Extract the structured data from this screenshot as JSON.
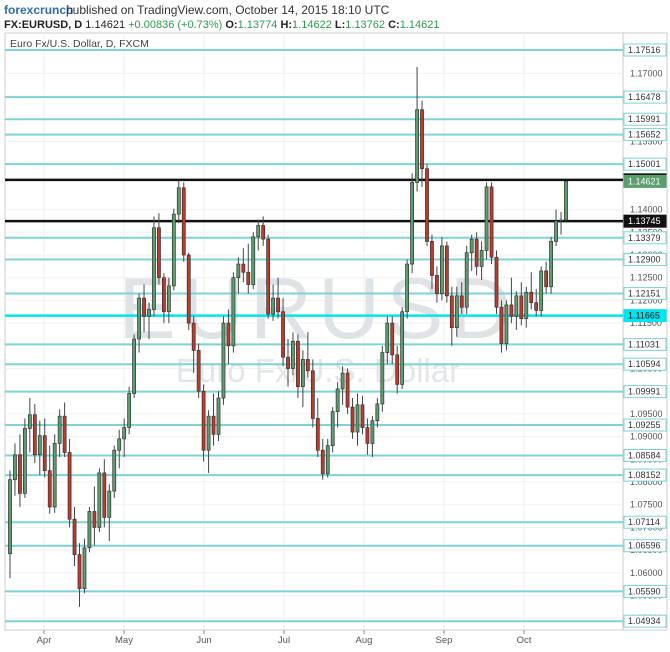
{
  "header": {
    "brand": "forexcrunch",
    "published": "published on TradingView.com, October 14, 2015 18:10 UTC"
  },
  "ohlc": {
    "symbol": "FX:EURUSD, D",
    "last": "1.14621",
    "change": "+0.00836 (+0.73%)",
    "open_label": "O:",
    "open": "1.13774",
    "high_label": "H:",
    "high": "1.14622",
    "low_label": "L:",
    "low": "1.13762",
    "close_label": "C:",
    "close": "1.14621"
  },
  "colors": {
    "up": "#5a9e6e",
    "down": "#c0392b",
    "level_line": "#7fd3d6",
    "key_line": "#111111",
    "highlight_line": "#00e5ef",
    "grid": "#eef0f2"
  },
  "chart_data": {
    "type": "candlestick",
    "title": "Euro Fx/U.S. Dollar, D, FXCM",
    "watermark": "EURUSD",
    "watermark_sub": "Euro Fx/U.S. Dollar",
    "x_ticks": [
      "Apr",
      "May",
      "Jun",
      "Jul",
      "Aug",
      "Sep",
      "Oct"
    ],
    "y_ticks": [
      "1.17000",
      "1.16500",
      "1.15500",
      "1.15000",
      "1.14000",
      "1.13500",
      "1.13000",
      "1.12500",
      "1.12000",
      "1.11500",
      "1.10500",
      "1.10000",
      "1.09500",
      "1.09000",
      "1.08500",
      "1.08000",
      "1.07500",
      "1.07000",
      "1.06500",
      "1.06000",
      "1.05500",
      "1.05000"
    ],
    "ylim": [
      1.0474,
      1.1789
    ],
    "levels": [
      {
        "value": 1.17516,
        "label": "1.17516",
        "style": "level"
      },
      {
        "value": 1.16478,
        "label": "1.16478",
        "style": "level"
      },
      {
        "value": 1.15991,
        "label": "1.15991",
        "style": "level"
      },
      {
        "value": 1.15652,
        "label": "1.15652",
        "style": "level"
      },
      {
        "value": 1.15001,
        "label": "1.15001",
        "style": "level"
      },
      {
        "value": 1.14656,
        "label": "1.14656",
        "style": "key"
      },
      {
        "value": 1.13745,
        "label": "1.13745",
        "style": "key"
      },
      {
        "value": 1.13379,
        "label": "1.13379",
        "style": "level"
      },
      {
        "value": 1.129,
        "label": "1.12900",
        "style": "level"
      },
      {
        "value": 1.12151,
        "label": "1.12151",
        "style": "level"
      },
      {
        "value": 1.11665,
        "label": "1.11665",
        "style": "highlight"
      },
      {
        "value": 1.11031,
        "label": "1.11031",
        "style": "level"
      },
      {
        "value": 1.10594,
        "label": "1.10594",
        "style": "level"
      },
      {
        "value": 1.09991,
        "label": "1.09991",
        "style": "level"
      },
      {
        "value": 1.09255,
        "label": "1.09255",
        "style": "level"
      },
      {
        "value": 1.08584,
        "label": "1.08584",
        "style": "level"
      },
      {
        "value": 1.08152,
        "label": "1.08152",
        "style": "level"
      },
      {
        "value": 1.07114,
        "label": "1.07114",
        "style": "level"
      },
      {
        "value": 1.06596,
        "label": "1.06596",
        "style": "level"
      },
      {
        "value": 1.0559,
        "label": "1.05590",
        "style": "level"
      },
      {
        "value": 1.04934,
        "label": "1.04934",
        "style": "level"
      }
    ],
    "last_price": {
      "value": 1.14621,
      "label": "1.14621"
    },
    "candles": [
      {
        "o": 1.0642,
        "h": 1.0825,
        "l": 1.0588,
        "c": 1.0805
      },
      {
        "o": 1.0805,
        "h": 1.0885,
        "l": 1.077,
        "c": 1.086
      },
      {
        "o": 1.086,
        "h": 1.0905,
        "l": 1.0745,
        "c": 1.0775
      },
      {
        "o": 1.0775,
        "h": 1.094,
        "l": 1.0765,
        "c": 1.0918
      },
      {
        "o": 1.0918,
        "h": 1.0985,
        "l": 1.0865,
        "c": 1.0948
      },
      {
        "o": 1.0948,
        "h": 1.0972,
        "l": 1.0842,
        "c": 1.086
      },
      {
        "o": 1.086,
        "h": 1.0935,
        "l": 1.0815,
        "c": 1.0902
      },
      {
        "o": 1.0902,
        "h": 1.094,
        "l": 1.081,
        "c": 1.0825
      },
      {
        "o": 1.0825,
        "h": 1.088,
        "l": 1.073,
        "c": 1.0745
      },
      {
        "o": 1.0745,
        "h": 1.0905,
        "l": 1.0732,
        "c": 1.0885
      },
      {
        "o": 1.0885,
        "h": 1.096,
        "l": 1.0855,
        "c": 1.0945
      },
      {
        "o": 1.0945,
        "h": 1.0975,
        "l": 1.0855,
        "c": 1.0865
      },
      {
        "o": 1.0865,
        "h": 1.0895,
        "l": 1.07,
        "c": 1.0718
      },
      {
        "o": 1.0718,
        "h": 1.0745,
        "l": 1.0615,
        "c": 1.064
      },
      {
        "o": 1.064,
        "h": 1.0665,
        "l": 1.0525,
        "c": 1.0565
      },
      {
        "o": 1.0565,
        "h": 1.0675,
        "l": 1.0555,
        "c": 1.0655
      },
      {
        "o": 1.0655,
        "h": 1.0745,
        "l": 1.0645,
        "c": 1.0735
      },
      {
        "o": 1.0735,
        "h": 1.079,
        "l": 1.066,
        "c": 1.07
      },
      {
        "o": 1.07,
        "h": 1.083,
        "l": 1.069,
        "c": 1.082
      },
      {
        "o": 1.082,
        "h": 1.085,
        "l": 1.07,
        "c": 1.0722
      },
      {
        "o": 1.0722,
        "h": 1.0795,
        "l": 1.067,
        "c": 1.078
      },
      {
        "o": 1.078,
        "h": 1.088,
        "l": 1.0765,
        "c": 1.087
      },
      {
        "o": 1.087,
        "h": 1.0915,
        "l": 1.083,
        "c": 1.0895
      },
      {
        "o": 1.0895,
        "h": 1.094,
        "l": 1.0855,
        "c": 1.092
      },
      {
        "o": 1.092,
        "h": 1.101,
        "l": 1.0905,
        "c": 1.0995
      },
      {
        "o": 1.0995,
        "h": 1.1125,
        "l": 1.0985,
        "c": 1.1115
      },
      {
        "o": 1.1115,
        "h": 1.1215,
        "l": 1.1085,
        "c": 1.1205
      },
      {
        "o": 1.1205,
        "h": 1.1235,
        "l": 1.113,
        "c": 1.1165
      },
      {
        "o": 1.1165,
        "h": 1.1195,
        "l": 1.1115,
        "c": 1.118
      },
      {
        "o": 1.118,
        "h": 1.1385,
        "l": 1.1165,
        "c": 1.136
      },
      {
        "o": 1.136,
        "h": 1.1392,
        "l": 1.1235,
        "c": 1.125
      },
      {
        "o": 1.125,
        "h": 1.126,
        "l": 1.115,
        "c": 1.1175
      },
      {
        "o": 1.1175,
        "h": 1.125,
        "l": 1.115,
        "c": 1.1232
      },
      {
        "o": 1.1232,
        "h": 1.1402,
        "l": 1.1222,
        "c": 1.139
      },
      {
        "o": 1.139,
        "h": 1.1466,
        "l": 1.137,
        "c": 1.1448
      },
      {
        "o": 1.1448,
        "h": 1.146,
        "l": 1.1285,
        "c": 1.13
      },
      {
        "o": 1.13,
        "h": 1.1305,
        "l": 1.1135,
        "c": 1.115
      },
      {
        "o": 1.115,
        "h": 1.1165,
        "l": 1.104,
        "c": 1.109
      },
      {
        "o": 1.109,
        "h": 1.1105,
        "l": 1.0985,
        "c": 1.1
      },
      {
        "o": 1.1,
        "h": 1.1015,
        "l": 1.0845,
        "c": 1.087
      },
      {
        "o": 1.087,
        "h": 1.0958,
        "l": 1.082,
        "c": 1.0945
      },
      {
        "o": 1.0945,
        "h": 1.0995,
        "l": 1.088,
        "c": 1.0905
      },
      {
        "o": 1.0905,
        "h": 1.1,
        "l": 1.089,
        "c": 1.0985
      },
      {
        "o": 1.0985,
        "h": 1.1165,
        "l": 1.097,
        "c": 1.115
      },
      {
        "o": 1.115,
        "h": 1.118,
        "l": 1.106,
        "c": 1.11
      },
      {
        "o": 1.11,
        "h": 1.1262,
        "l": 1.1085,
        "c": 1.125
      },
      {
        "o": 1.125,
        "h": 1.1295,
        "l": 1.1215,
        "c": 1.128
      },
      {
        "o": 1.128,
        "h": 1.1315,
        "l": 1.124,
        "c": 1.1262
      },
      {
        "o": 1.1262,
        "h": 1.1325,
        "l": 1.1215,
        "c": 1.1235
      },
      {
        "o": 1.1235,
        "h": 1.135,
        "l": 1.1225,
        "c": 1.134
      },
      {
        "o": 1.134,
        "h": 1.1378,
        "l": 1.131,
        "c": 1.1365
      },
      {
        "o": 1.1365,
        "h": 1.1385,
        "l": 1.132,
        "c": 1.1335
      },
      {
        "o": 1.1335,
        "h": 1.1345,
        "l": 1.116,
        "c": 1.117
      },
      {
        "o": 1.117,
        "h": 1.1235,
        "l": 1.1155,
        "c": 1.1205
      },
      {
        "o": 1.1205,
        "h": 1.125,
        "l": 1.116,
        "c": 1.1175
      },
      {
        "o": 1.1175,
        "h": 1.1205,
        "l": 1.1055,
        "c": 1.1075
      },
      {
        "o": 1.1075,
        "h": 1.1115,
        "l": 1.101,
        "c": 1.105
      },
      {
        "o": 1.105,
        "h": 1.113,
        "l": 1.1035,
        "c": 1.111
      },
      {
        "o": 1.111,
        "h": 1.1125,
        "l": 1.0985,
        "c": 1.101
      },
      {
        "o": 1.101,
        "h": 1.109,
        "l": 1.0965,
        "c": 1.107
      },
      {
        "o": 1.107,
        "h": 1.113,
        "l": 1.103,
        "c": 1.1045
      },
      {
        "o": 1.1045,
        "h": 1.107,
        "l": 1.092,
        "c": 1.094
      },
      {
        "o": 1.094,
        "h": 1.0985,
        "l": 1.0855,
        "c": 1.087
      },
      {
        "o": 1.087,
        "h": 1.0895,
        "l": 1.0805,
        "c": 1.0818
      },
      {
        "o": 1.0818,
        "h": 1.0895,
        "l": 1.081,
        "c": 1.088
      },
      {
        "o": 1.088,
        "h": 1.0965,
        "l": 1.0865,
        "c": 1.0955
      },
      {
        "o": 1.0955,
        "h": 1.102,
        "l": 1.092,
        "c": 1.1005
      },
      {
        "o": 1.1005,
        "h": 1.1055,
        "l": 1.097,
        "c": 1.104
      },
      {
        "o": 1.104,
        "h": 1.105,
        "l": 1.095,
        "c": 1.0965
      },
      {
        "o": 1.0965,
        "h": 1.0985,
        "l": 1.0895,
        "c": 1.091
      },
      {
        "o": 1.091,
        "h": 1.0995,
        "l": 1.088,
        "c": 1.097
      },
      {
        "o": 1.097,
        "h": 1.099,
        "l": 1.0905,
        "c": 1.092
      },
      {
        "o": 1.092,
        "h": 1.094,
        "l": 1.086,
        "c": 1.0885
      },
      {
        "o": 1.0885,
        "h": 1.0945,
        "l": 1.0855,
        "c": 1.0935
      },
      {
        "o": 1.0935,
        "h": 1.0985,
        "l": 1.092,
        "c": 1.0972
      },
      {
        "o": 1.0972,
        "h": 1.11,
        "l": 1.0955,
        "c": 1.1085
      },
      {
        "o": 1.1085,
        "h": 1.1165,
        "l": 1.106,
        "c": 1.115
      },
      {
        "o": 1.115,
        "h": 1.1165,
        "l": 1.106,
        "c": 1.108
      },
      {
        "o": 1.108,
        "h": 1.11,
        "l": 1.0995,
        "c": 1.1015
      },
      {
        "o": 1.1015,
        "h": 1.1185,
        "l": 1.1005,
        "c": 1.1175
      },
      {
        "o": 1.1175,
        "h": 1.129,
        "l": 1.116,
        "c": 1.128
      },
      {
        "o": 1.128,
        "h": 1.148,
        "l": 1.126,
        "c": 1.146
      },
      {
        "o": 1.146,
        "h": 1.1714,
        "l": 1.144,
        "c": 1.162
      },
      {
        "o": 1.162,
        "h": 1.164,
        "l": 1.145,
        "c": 1.149
      },
      {
        "o": 1.149,
        "h": 1.15,
        "l": 1.132,
        "c": 1.133
      },
      {
        "o": 1.133,
        "h": 1.1345,
        "l": 1.1225,
        "c": 1.1255
      },
      {
        "o": 1.1255,
        "h": 1.1275,
        "l": 1.1195,
        "c": 1.1215
      },
      {
        "o": 1.1215,
        "h": 1.134,
        "l": 1.12,
        "c": 1.132
      },
      {
        "o": 1.132,
        "h": 1.133,
        "l": 1.1195,
        "c": 1.121
      },
      {
        "o": 1.121,
        "h": 1.123,
        "l": 1.11,
        "c": 1.114
      },
      {
        "o": 1.114,
        "h": 1.123,
        "l": 1.112,
        "c": 1.121
      },
      {
        "o": 1.121,
        "h": 1.124,
        "l": 1.117,
        "c": 1.1185
      },
      {
        "o": 1.1185,
        "h": 1.132,
        "l": 1.117,
        "c": 1.1305
      },
      {
        "o": 1.1305,
        "h": 1.1345,
        "l": 1.1265,
        "c": 1.1335
      },
      {
        "o": 1.1335,
        "h": 1.135,
        "l": 1.1255,
        "c": 1.1275
      },
      {
        "o": 1.1275,
        "h": 1.133,
        "l": 1.1245,
        "c": 1.131
      },
      {
        "o": 1.131,
        "h": 1.146,
        "l": 1.129,
        "c": 1.145
      },
      {
        "o": 1.145,
        "h": 1.146,
        "l": 1.128,
        "c": 1.1295
      },
      {
        "o": 1.1295,
        "h": 1.131,
        "l": 1.117,
        "c": 1.1185
      },
      {
        "o": 1.1185,
        "h": 1.12,
        "l": 1.1085,
        "c": 1.1105
      },
      {
        "o": 1.1105,
        "h": 1.12,
        "l": 1.109,
        "c": 1.119
      },
      {
        "o": 1.119,
        "h": 1.125,
        "l": 1.115,
        "c": 1.1165
      },
      {
        "o": 1.1165,
        "h": 1.122,
        "l": 1.1135,
        "c": 1.121
      },
      {
        "o": 1.121,
        "h": 1.124,
        "l": 1.1145,
        "c": 1.116
      },
      {
        "o": 1.116,
        "h": 1.123,
        "l": 1.114,
        "c": 1.1218
      },
      {
        "o": 1.1218,
        "h": 1.1262,
        "l": 1.118,
        "c": 1.1195
      },
      {
        "o": 1.1195,
        "h": 1.1225,
        "l": 1.1165,
        "c": 1.1178
      },
      {
        "o": 1.1178,
        "h": 1.1275,
        "l": 1.1165,
        "c": 1.1265
      },
      {
        "o": 1.1265,
        "h": 1.1285,
        "l": 1.1215,
        "c": 1.123
      },
      {
        "o": 1.123,
        "h": 1.134,
        "l": 1.1215,
        "c": 1.133
      },
      {
        "o": 1.133,
        "h": 1.14,
        "l": 1.132,
        "c": 1.1375
      },
      {
        "o": 1.1375,
        "h": 1.1395,
        "l": 1.1345,
        "c": 1.1377
      },
      {
        "o": 1.1377,
        "h": 1.1462,
        "l": 1.1376,
        "c": 1.1462
      }
    ]
  }
}
